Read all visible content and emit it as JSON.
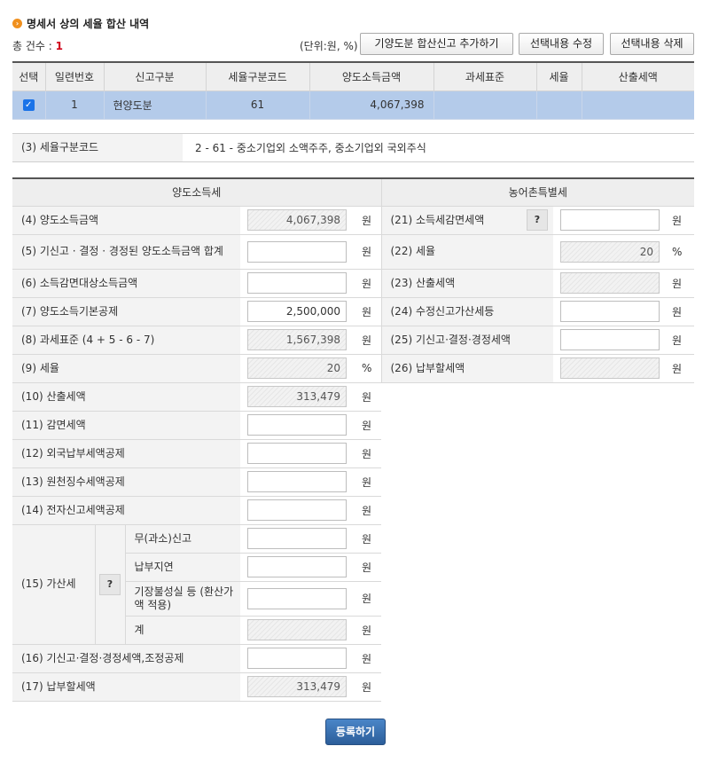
{
  "header": {
    "icon": "chevron-right-circle-icon",
    "title": "명세서 상의 세율 합산 내역"
  },
  "count": {
    "label": "총 건수 :",
    "value": "1"
  },
  "unit_label": "(단위:원, %)",
  "toolbar": {
    "add_label": "기양도분 합산신고 추가하기",
    "edit_label": "선택내용 수정",
    "delete_label": "선택내용 삭제"
  },
  "grid": {
    "columns": [
      "선택",
      "일련번호",
      "신고구분",
      "세율구분코드",
      "양도소득금액",
      "과세표준",
      "세율",
      "산출세액"
    ],
    "rows": [
      {
        "checked": true,
        "serial": "1",
        "type": "현양도분",
        "code": "61",
        "amount": "4,067,398",
        "base": "",
        "rate": "",
        "tax": ""
      }
    ]
  },
  "code_row": {
    "label": "(3) 세율구분코드",
    "value": "2  -  61  -  중소기업외 소액주주, 중소기업외 국외주식"
  },
  "sections": {
    "left": "양도소득세",
    "right": "농어촌특별세"
  },
  "units": {
    "won": "원",
    "pct": "%"
  },
  "help_icon": "question-icon",
  "help_text": "?",
  "rows": {
    "r4": {
      "label": "(4) 양도소득금액",
      "value": "4,067,398"
    },
    "r5": {
      "label": "(5) 기신고 · 결정 · 경정된 양도소득금액 합계",
      "value": ""
    },
    "r6": {
      "label": "(6) 소득감면대상소득금액",
      "value": ""
    },
    "r7": {
      "label": "(7) 양도소득기본공제",
      "value": "2,500,000"
    },
    "r8": {
      "label": "(8) 과세표준 (4 + 5 - 6 - 7)",
      "value": "1,567,398"
    },
    "r9": {
      "label": "(9) 세율",
      "value": "20"
    },
    "r10": {
      "label": "(10) 산출세액",
      "value": "313,479"
    },
    "r11": {
      "label": "(11) 감면세액",
      "value": ""
    },
    "r12": {
      "label": "(12) 외국납부세액공제",
      "value": ""
    },
    "r13": {
      "label": "(13) 원천징수세액공제",
      "value": ""
    },
    "r14": {
      "label": "(14) 전자신고세액공제",
      "value": ""
    },
    "r15": {
      "label": "(15) 가산세",
      "sub1": "무(과소)신고",
      "v1": "",
      "sub2": "납부지연",
      "v2": "",
      "sub3": "기장불성실 등 (환산가액 적용)",
      "v3": "",
      "sub4": "계",
      "v4": ""
    },
    "r16": {
      "label": "(16) 기신고·결정·경정세액,조정공제",
      "value": ""
    },
    "r17": {
      "label": "(17) 납부할세액",
      "value": "313,479"
    },
    "r21": {
      "label": "(21) 소득세감면세액",
      "value": ""
    },
    "r22": {
      "label": "(22) 세율",
      "value": "20"
    },
    "r23": {
      "label": "(23) 산출세액",
      "value": ""
    },
    "r24": {
      "label": "(24) 수정신고가산세등",
      "value": ""
    },
    "r25": {
      "label": "(25) 기신고·결정·경정세액",
      "value": ""
    },
    "r26": {
      "label": "(26) 납부할세액",
      "value": ""
    }
  },
  "submit_label": "등록하기"
}
